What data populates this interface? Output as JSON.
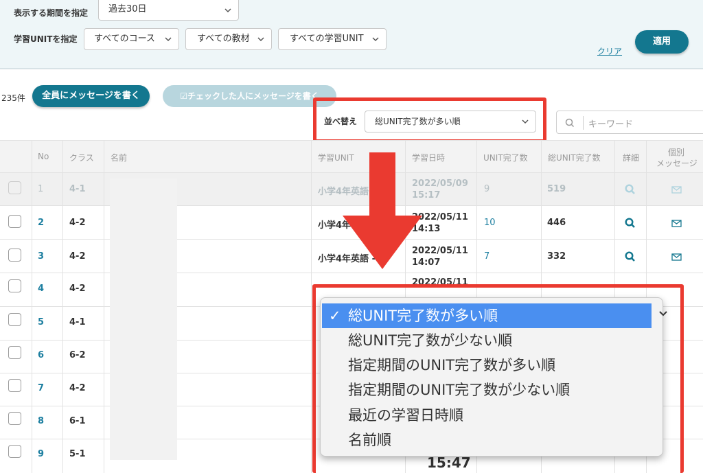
{
  "filter": {
    "period_label": "表示する期間を指定",
    "period_value": "過去30日",
    "unit_label": "学習UNITを指定",
    "course_value": "すべてのコース",
    "material_value": "すべての教材",
    "unit_value": "すべての学習UNIT",
    "clear_label": "クリア",
    "apply_label": "適用"
  },
  "toolbar": {
    "count": "235件",
    "message_all": "全員にメッセージを書く",
    "message_checked": "☑チェックした人にメッセージを書く",
    "sort_label": "並べ替え",
    "sort_value": "総UNIT完了数が多い順",
    "search_placeholder": "キーワード"
  },
  "table": {
    "headers": {
      "no": "No",
      "class": "クラス",
      "name": "名前",
      "unit": "学習UNIT",
      "date": "学習日時",
      "unit_done": "UNIT完了数",
      "total_done": "総UNIT完了数",
      "detail": "詳細",
      "message_line1": "個別",
      "message_line2": "メッセージ"
    },
    "rows": [
      {
        "no": "1",
        "class": "4-1",
        "unit": "小学4年英語",
        "date1": "2022/05/09",
        "date2": "15:17",
        "done": "9",
        "total": "519"
      },
      {
        "no": "2",
        "class": "4-2",
        "unit": "小学4年",
        "date1": "2022/05/11",
        "date2": "14:13",
        "done": "10",
        "total": "446"
      },
      {
        "no": "3",
        "class": "4-2",
        "unit": "小学4年英語 -",
        "date1": "2022/05/11",
        "date2": "14:07",
        "done": "7",
        "total": "332"
      },
      {
        "no": "4",
        "class": "4-2",
        "unit": "",
        "date1": "2022/05/11",
        "date2": "",
        "done": "",
        "total": ""
      },
      {
        "no": "5",
        "class": "4-1"
      },
      {
        "no": "6",
        "class": "6-2"
      },
      {
        "no": "7",
        "class": "4-2"
      },
      {
        "no": "8",
        "class": "6-1"
      },
      {
        "no": "9",
        "class": "5-1",
        "date2": "15:47"
      }
    ]
  },
  "dropdown": {
    "options": [
      "総UNIT完了数が多い順",
      "総UNIT完了数が少ない順",
      "指定期間のUNIT完了数が多い順",
      "指定期間のUNIT完了数が少ない順",
      "最近の学習日時順",
      "名前順"
    ],
    "check": "✓"
  },
  "colors": {
    "accent": "#13778f",
    "highlight": "#ea3a30",
    "selected": "#4a8ff0"
  }
}
